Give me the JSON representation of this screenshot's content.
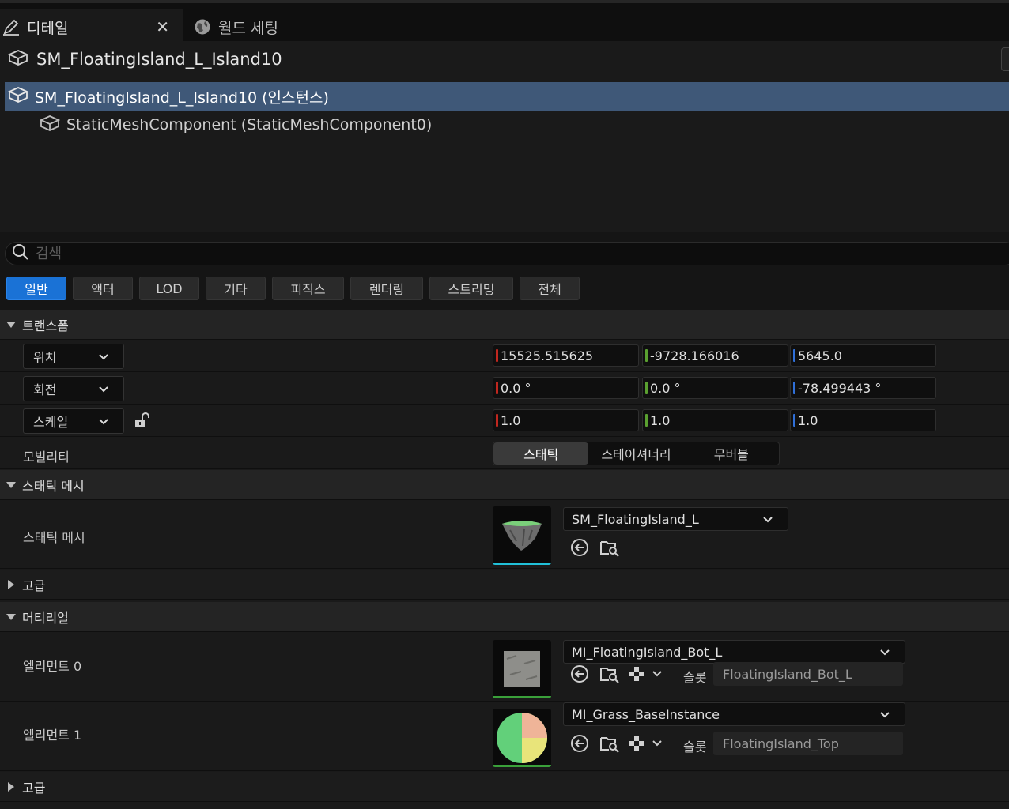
{
  "tabs": [
    {
      "label": "디테일",
      "icon": "pencil-icon",
      "active": true
    },
    {
      "label": "월드 세팅",
      "icon": "globe-icon",
      "active": false
    }
  ],
  "actor": {
    "name": "SM_FloatingIsland_L_Island10"
  },
  "components": [
    {
      "label": "SM_FloatingIsland_L_Island10 (인스턴스)",
      "selected": true
    },
    {
      "label": "StaticMeshComponent (StaticMeshComponent0)",
      "selected": false
    }
  ],
  "search": {
    "placeholder": "검색",
    "value": ""
  },
  "filters": [
    "일반",
    "액터",
    "LOD",
    "기타",
    "피직스",
    "렌더링",
    "스트리밍",
    "전체"
  ],
  "transform": {
    "title": "트랜스폼",
    "location": {
      "label": "위치",
      "x": "15525.515625",
      "y": "-9728.166016",
      "z": "5645.0"
    },
    "rotation": {
      "label": "회전",
      "x": "0.0 °",
      "y": "0.0 °",
      "z": "-78.499443 °"
    },
    "scale": {
      "label": "스케일",
      "x": "1.0",
      "y": "1.0",
      "z": "1.0"
    },
    "mobility": {
      "label": "모빌리티",
      "options": [
        "스태틱",
        "스테이셔너리",
        "무버블"
      ],
      "selected": "스태틱"
    }
  },
  "static_mesh": {
    "title": "스태틱 메시",
    "label": "스태틱 메시",
    "asset": "SM_FloatingIsland_L"
  },
  "advanced1": {
    "title": "고급"
  },
  "materials": {
    "title": "머티리얼",
    "slot_label": "슬롯",
    "elements": [
      {
        "label": "엘리먼트 0",
        "asset": "MI_FloatingIsland_Bot_L",
        "slot": "FloatingIsland_Bot_L"
      },
      {
        "label": "엘리먼트 1",
        "asset": "MI_Grass_BaseInstance",
        "slot": "FloatingIsland_Top"
      }
    ]
  },
  "advanced2": {
    "title": "고급"
  },
  "colors": {
    "selection": "#3f5878",
    "accent": "#1a72d6",
    "axis_x": "#c0271f",
    "axis_y": "#5aa030",
    "axis_z": "#2f6fd8",
    "mesh_bar": "#21c0d8",
    "material_bar": "#3aa03a"
  }
}
